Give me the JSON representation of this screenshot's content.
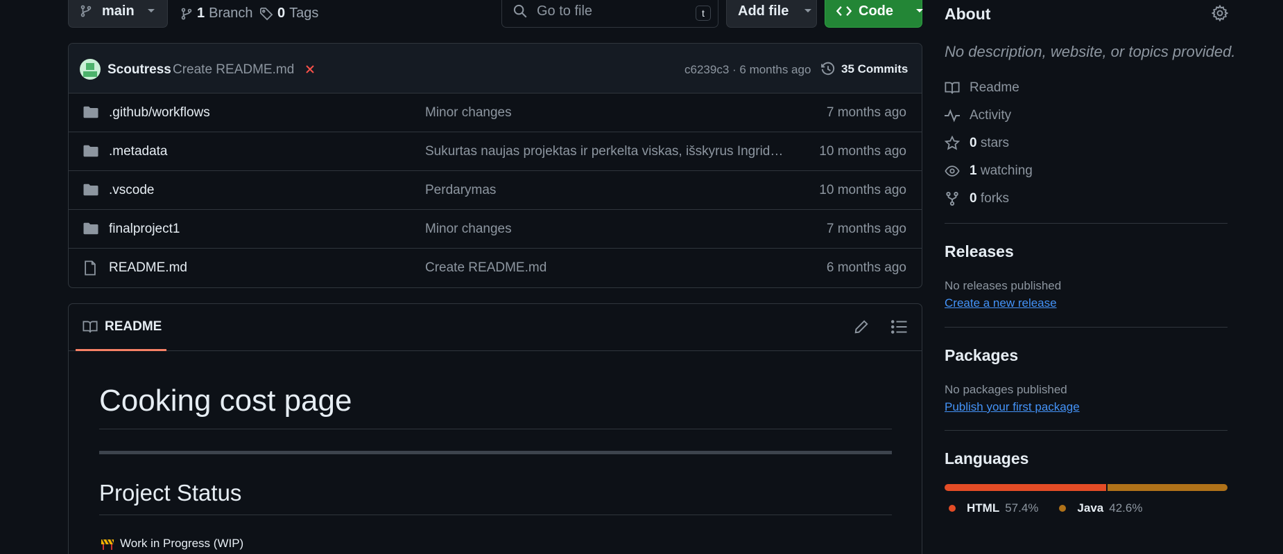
{
  "toolbar": {
    "branch_name": "main",
    "branch_count": "1",
    "branch_label": "Branch",
    "tag_count": "0",
    "tag_label": "Tags",
    "goto_placeholder": "Go to file",
    "goto_shortcut": "t",
    "add_file_label": "Add file",
    "code_label": "Code"
  },
  "commit": {
    "author": "Scoutress",
    "message": "Create README.md",
    "hash": "c6239c3",
    "time": "6 months ago",
    "commits_label": "35 Commits"
  },
  "files": [
    {
      "type": "folder",
      "name": ".github/workflows",
      "message": "Minor changes",
      "age": "7 months ago"
    },
    {
      "type": "folder",
      "name": ".metadata",
      "message": "Sukurtas naujas projektas ir perkelta viskas, išskyrus Ingridie...",
      "age": "10 months ago"
    },
    {
      "type": "folder",
      "name": ".vscode",
      "message": "Perdarymas",
      "age": "10 months ago"
    },
    {
      "type": "folder",
      "name": "finalproject1",
      "message": "Minor changes",
      "age": "7 months ago"
    },
    {
      "type": "file",
      "name": "README.md",
      "message": "Create README.md",
      "age": "6 months ago"
    }
  ],
  "readme": {
    "tab_label": "README",
    "h1": "Cooking cost page",
    "h2": "Project Status",
    "status_text": "Work in Progress (WIP)"
  },
  "about": {
    "title": "About",
    "description": "No description, website, or topics provided.",
    "readme_label": "Readme",
    "activity_label": "Activity",
    "stars_count": "0",
    "stars_label": "stars",
    "watching_count": "1",
    "watching_label": "watching",
    "forks_count": "0",
    "forks_label": "forks"
  },
  "releases": {
    "title": "Releases",
    "text": "No releases published",
    "link": "Create a new release"
  },
  "packages": {
    "title": "Packages",
    "text": "No packages published",
    "link": "Publish your first package"
  },
  "languages": {
    "title": "Languages",
    "items": [
      {
        "name": "HTML",
        "percent": "57.4%",
        "color": "#e34c26",
        "fraction": 0.574
      },
      {
        "name": "Java",
        "percent": "42.6%",
        "color": "#b07219",
        "fraction": 0.426
      }
    ]
  },
  "colors": {
    "accent_green": "#238636",
    "link_blue": "#4493f8",
    "tab_underline": "#f78166",
    "error_red": "#f85149"
  }
}
